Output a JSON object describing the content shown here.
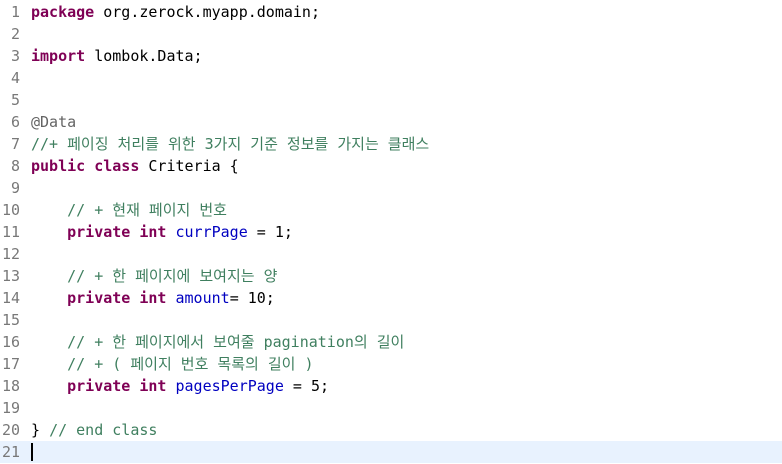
{
  "editor": {
    "lines": [
      {
        "num": "1",
        "tokens": [
          {
            "t": "package",
            "k": "kw"
          },
          {
            "t": " org.zerock.myapp.domain;",
            "k": "pl"
          }
        ]
      },
      {
        "num": "2",
        "tokens": []
      },
      {
        "num": "3",
        "tokens": [
          {
            "t": "import",
            "k": "kw"
          },
          {
            "t": " lombok.Data;",
            "k": "pl"
          }
        ]
      },
      {
        "num": "4",
        "tokens": []
      },
      {
        "num": "5",
        "tokens": []
      },
      {
        "num": "6",
        "tokens": [
          {
            "t": "@Data",
            "k": "an"
          }
        ]
      },
      {
        "num": "7",
        "tokens": [
          {
            "t": "//+ 페이징 처리를 위한 3가지 기준 정보를 가지는 클래스",
            "k": "cm"
          }
        ]
      },
      {
        "num": "8",
        "tokens": [
          {
            "t": "public",
            "k": "kw"
          },
          {
            "t": " ",
            "k": "pl"
          },
          {
            "t": "class",
            "k": "kw"
          },
          {
            "t": " Criteria {",
            "k": "pl"
          }
        ]
      },
      {
        "num": "9",
        "tokens": []
      },
      {
        "num": "10",
        "tokens": [
          {
            "t": "    ",
            "k": "pl"
          },
          {
            "t": "// + 현재 페이지 번호",
            "k": "cm"
          }
        ]
      },
      {
        "num": "11",
        "tokens": [
          {
            "t": "    ",
            "k": "pl"
          },
          {
            "t": "private",
            "k": "kw"
          },
          {
            "t": " ",
            "k": "pl"
          },
          {
            "t": "int",
            "k": "kw"
          },
          {
            "t": " ",
            "k": "pl"
          },
          {
            "t": "currPage",
            "k": "fd"
          },
          {
            "t": " = 1;",
            "k": "pl"
          }
        ]
      },
      {
        "num": "12",
        "tokens": []
      },
      {
        "num": "13",
        "tokens": [
          {
            "t": "    ",
            "k": "pl"
          },
          {
            "t": "// + 한 페이지에 보여지는 양",
            "k": "cm"
          }
        ]
      },
      {
        "num": "14",
        "tokens": [
          {
            "t": "    ",
            "k": "pl"
          },
          {
            "t": "private",
            "k": "kw"
          },
          {
            "t": " ",
            "k": "pl"
          },
          {
            "t": "int",
            "k": "kw"
          },
          {
            "t": " ",
            "k": "pl"
          },
          {
            "t": "amount",
            "k": "fd"
          },
          {
            "t": "= 10;",
            "k": "pl"
          }
        ]
      },
      {
        "num": "15",
        "tokens": []
      },
      {
        "num": "16",
        "tokens": [
          {
            "t": "    ",
            "k": "pl"
          },
          {
            "t": "// + 한 페이지에서 보여줄 pagination의 길이",
            "k": "cm"
          }
        ]
      },
      {
        "num": "17",
        "tokens": [
          {
            "t": "    ",
            "k": "pl"
          },
          {
            "t": "// + ( 페이지 번호 목록의 길이 )",
            "k": "cm"
          }
        ]
      },
      {
        "num": "18",
        "tokens": [
          {
            "t": "    ",
            "k": "pl"
          },
          {
            "t": "private",
            "k": "kw"
          },
          {
            "t": " ",
            "k": "pl"
          },
          {
            "t": "int",
            "k": "kw"
          },
          {
            "t": " ",
            "k": "pl"
          },
          {
            "t": "pagesPerPage",
            "k": "fd"
          },
          {
            "t": " = 5;",
            "k": "pl"
          }
        ]
      },
      {
        "num": "19",
        "tokens": []
      },
      {
        "num": "20",
        "tokens": [
          {
            "t": "} ",
            "k": "pl"
          },
          {
            "t": "// end class",
            "k": "cm"
          }
        ]
      },
      {
        "num": "21",
        "tokens": []
      }
    ],
    "current_line": "21",
    "colors": {
      "keyword": "#7f0055",
      "comment": "#3f7f5f",
      "annotation": "#646464",
      "field": "#0000c0",
      "line_number": "#787878",
      "current_line_bg": "#e8f2fe"
    }
  }
}
